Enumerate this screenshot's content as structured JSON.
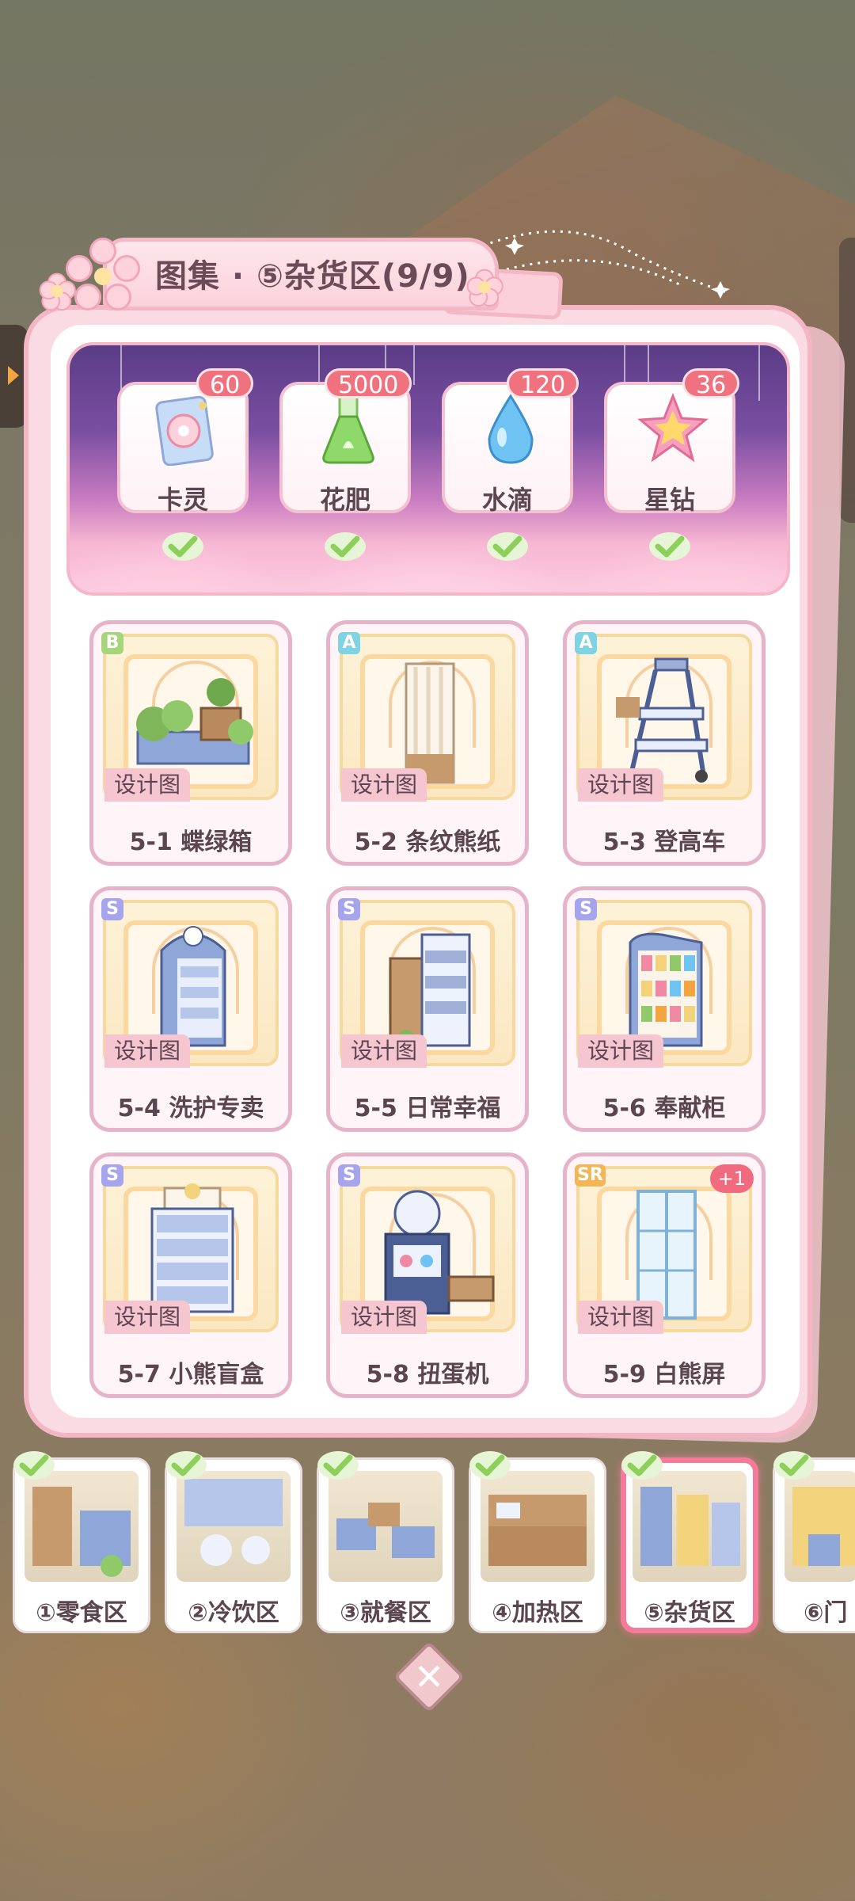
{
  "title": "图集 · ⑤杂货区(9/9)",
  "rewards": [
    {
      "label": "卡灵",
      "count": "60",
      "icon": "card-spirit-icon",
      "claimed": true
    },
    {
      "label": "花肥",
      "count": "5000",
      "icon": "fertilizer-flask-icon",
      "claimed": true
    },
    {
      "label": "水滴",
      "count": "120",
      "icon": "water-drop-icon",
      "claimed": true
    },
    {
      "label": "星钻",
      "count": "36",
      "icon": "star-diamond-icon",
      "claimed": true
    }
  ],
  "blueprint_tag": "设计图",
  "items": [
    {
      "grade": "B",
      "name": "5-1 蝶绿箱",
      "icon": "plant-box-icon"
    },
    {
      "grade": "A",
      "name": "5-2 条纹熊纸",
      "icon": "striped-wallpaper-icon"
    },
    {
      "grade": "A",
      "name": "5-3 登高车",
      "icon": "step-ladder-cart-icon"
    },
    {
      "grade": "S",
      "name": "5-4 洗护专卖",
      "icon": "toiletry-shelf-icon"
    },
    {
      "grade": "S",
      "name": "5-5 日常幸福",
      "icon": "daily-goods-shelf-icon"
    },
    {
      "grade": "S",
      "name": "5-6 奉献柜",
      "icon": "snack-cabinet-icon"
    },
    {
      "grade": "S",
      "name": "5-7 小熊盲盒",
      "icon": "blind-box-cabinet-icon"
    },
    {
      "grade": "S",
      "name": "5-8 扭蛋机",
      "icon": "gacha-machine-icon"
    },
    {
      "grade": "SR",
      "name": "5-9 白熊屏",
      "icon": "bear-screen-icon",
      "badge": "+1"
    }
  ],
  "areas": [
    {
      "label": "①零食区",
      "completed": true,
      "active": false
    },
    {
      "label": "②冷饮区",
      "completed": true,
      "active": false
    },
    {
      "label": "③就餐区",
      "completed": true,
      "active": false
    },
    {
      "label": "④加热区",
      "completed": true,
      "active": false
    },
    {
      "label": "⑤杂货区",
      "completed": true,
      "active": true
    },
    {
      "label": "⑥门",
      "completed": true,
      "active": false
    }
  ],
  "close_icon": "close-icon",
  "colors": {
    "accent_pink": "#f47b99",
    "badge_red": "#f0727f",
    "check_green": "#8ccf5a",
    "panel_border": "#f4b6c5",
    "banner_purple": "#5b3c86"
  }
}
